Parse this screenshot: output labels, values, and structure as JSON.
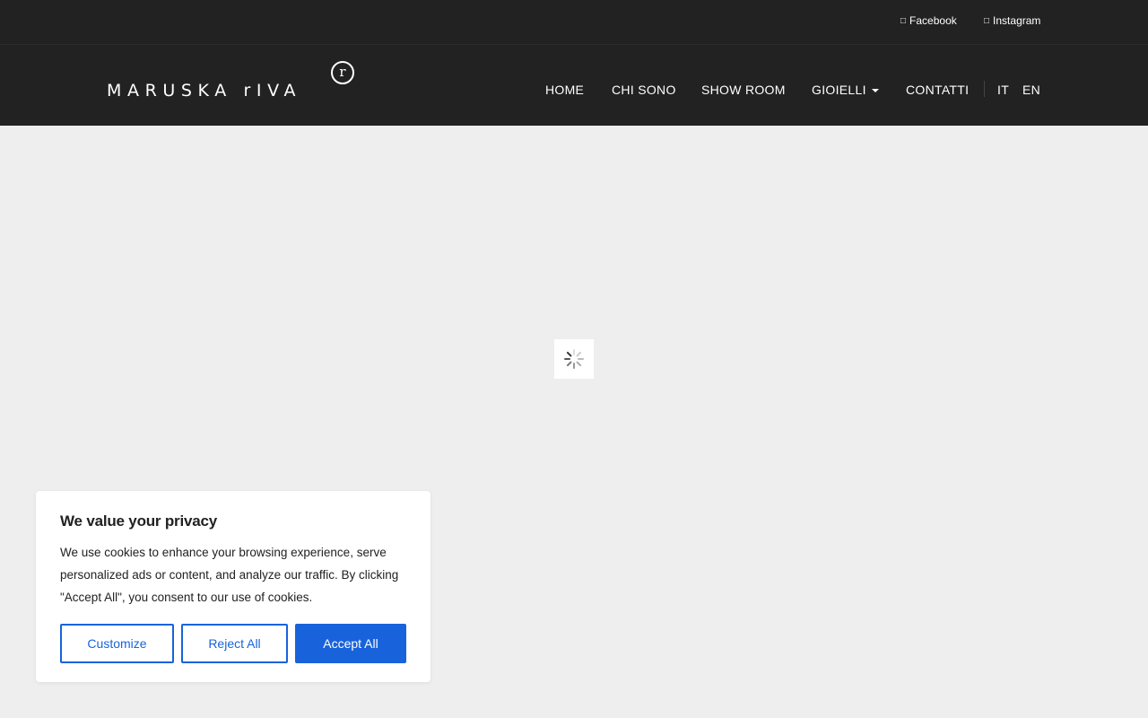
{
  "topbar": {
    "facebook": {
      "icon": "facebook-icon",
      "glyph": "□",
      "label": "Facebook"
    },
    "instagram": {
      "icon": "instagram-icon",
      "glyph": "□",
      "label": "Instagram"
    }
  },
  "logo": {
    "text": "MARUSKA rIVA",
    "mark": "r"
  },
  "nav": {
    "home": "HOME",
    "chi_sono": "CHI SONO",
    "show_room": "SHOW ROOM",
    "gioielli": "GIOIELLI",
    "contatti": "CONTATTI"
  },
  "languages": {
    "it": "IT",
    "en": "EN"
  },
  "loader": {
    "icon": "loading-spinner-icon"
  },
  "cookie": {
    "title": "We value your privacy",
    "body": "We use cookies to enhance your browsing experience, serve personalized ads or content, and analyze our traffic. By clicking \"Accept All\", you consent to our use of cookies.",
    "customize_label": "Customize",
    "reject_label": "Reject All",
    "accept_label": "Accept All"
  },
  "colors": {
    "header_bg": "#222222",
    "page_bg": "#eeeeee",
    "accent": "#1863dc",
    "text": "#212121"
  }
}
